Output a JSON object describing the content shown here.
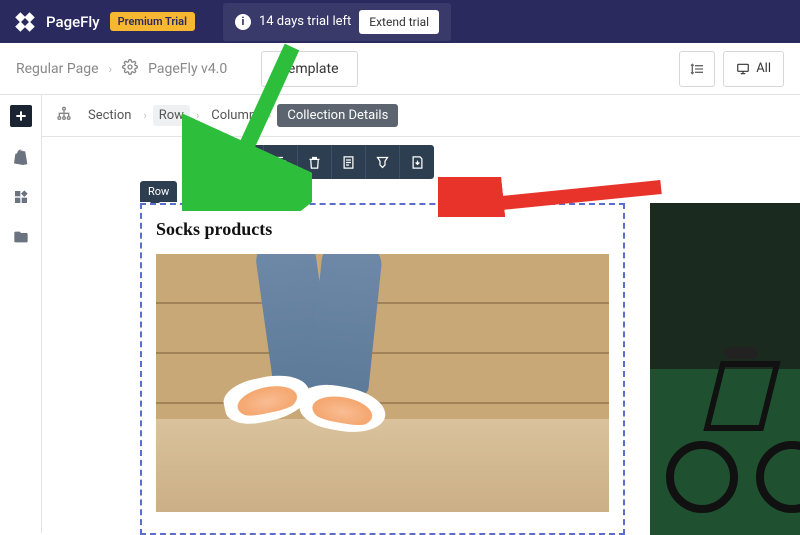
{
  "topbar": {
    "brand": "PageFly",
    "trial_badge": "Premium Trial",
    "trial_text": "14 days trial left",
    "extend_label": "Extend trial"
  },
  "subbar": {
    "crumb1": "Regular Page",
    "crumb2": "PageFly v4.0",
    "template_label": "Template",
    "all_label": "All"
  },
  "pathbar": {
    "seg1": "Section",
    "seg2": "Row",
    "seg3": "Column",
    "seg4": "Collection Details"
  },
  "canvas": {
    "row_label": "Row",
    "collection_title": "Socks products"
  }
}
